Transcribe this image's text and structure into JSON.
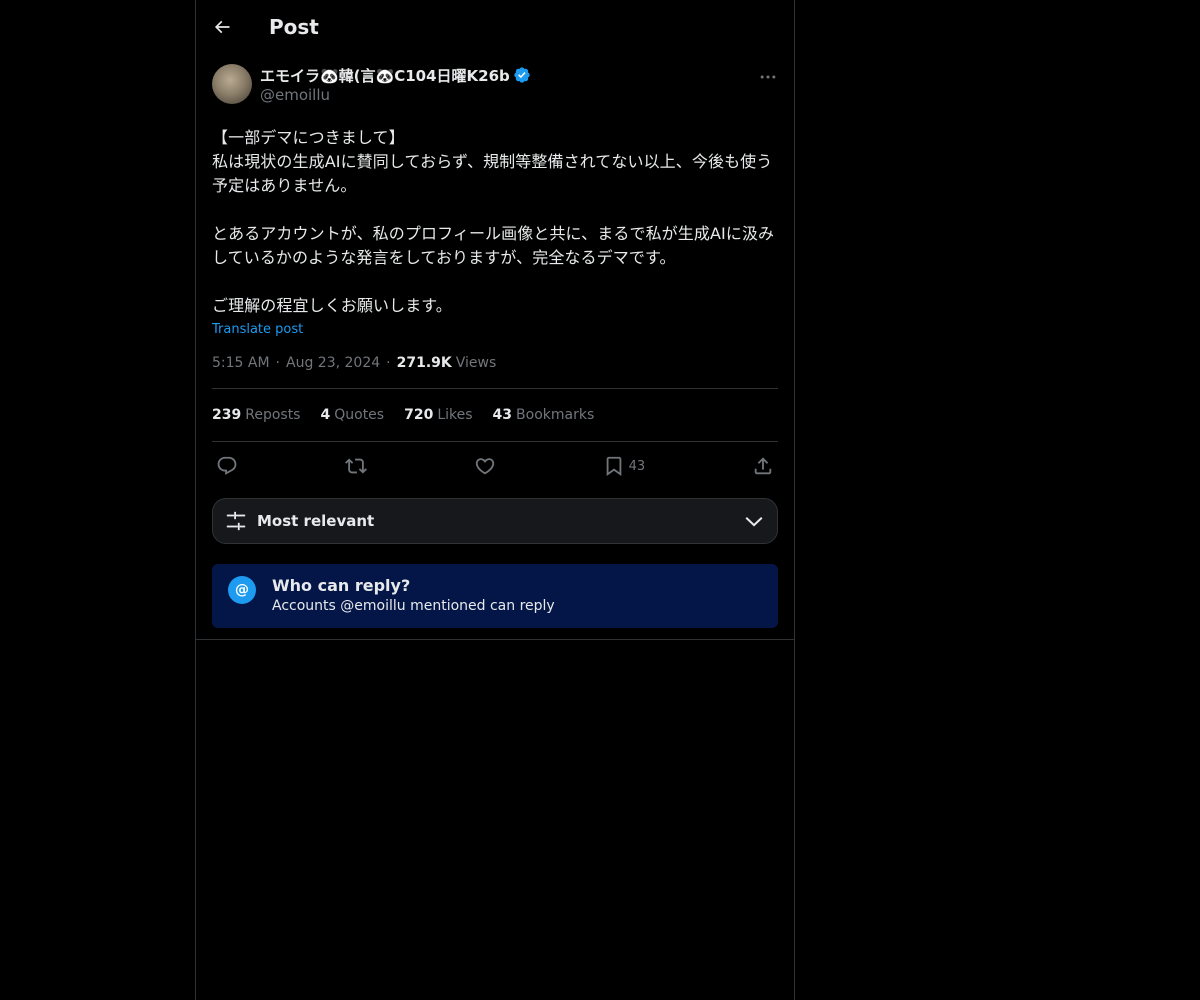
{
  "header": {
    "title": "Post"
  },
  "post": {
    "author": {
      "display_name": "エモイラ🐼韓(言🐼C104日曜K26b",
      "handle": "@emoillu",
      "verified": true
    },
    "text": "【一部デマにつきまして】\n私は現状の生成AIに賛同しておらず、規制等整備されてない以上、今後も使う予定はありません。\n\nとあるアカウントが、私のプロフィール画像と共に、まるで私が生成AIに汲みしているかのような発言をしておりますが、完全なるデマです。\n\nご理解の程宜しくお願いします。",
    "translate_label": "Translate post",
    "time": "5:15 AM",
    "date": "Aug 23, 2024",
    "views_count": "271.9K",
    "views_label": "Views",
    "separator": "·",
    "stats": {
      "reposts": {
        "count": "239",
        "label": "Reposts"
      },
      "quotes": {
        "count": "4",
        "label": "Quotes"
      },
      "likes": {
        "count": "720",
        "label": "Likes"
      },
      "bookmarks": {
        "count": "43",
        "label": "Bookmarks"
      }
    },
    "actions": {
      "bookmark_count": "43"
    }
  },
  "sort": {
    "label": "Most relevant"
  },
  "reply_restriction": {
    "icon_glyph": "@",
    "title": "Who can reply?",
    "subtitle": "Accounts @emoillu mentioned can reply"
  },
  "colors": {
    "background": "#000000",
    "accent": "#1d9bf0",
    "border": "#2f3336",
    "muted": "#71767b",
    "reply_box": "#031647"
  },
  "icons": [
    "back-arrow-icon",
    "verified-badge-icon",
    "more-icon",
    "reply-icon",
    "repost-icon",
    "like-icon",
    "bookmark-icon",
    "share-icon",
    "filter-icon",
    "chevron-down-icon",
    "at-icon"
  ]
}
